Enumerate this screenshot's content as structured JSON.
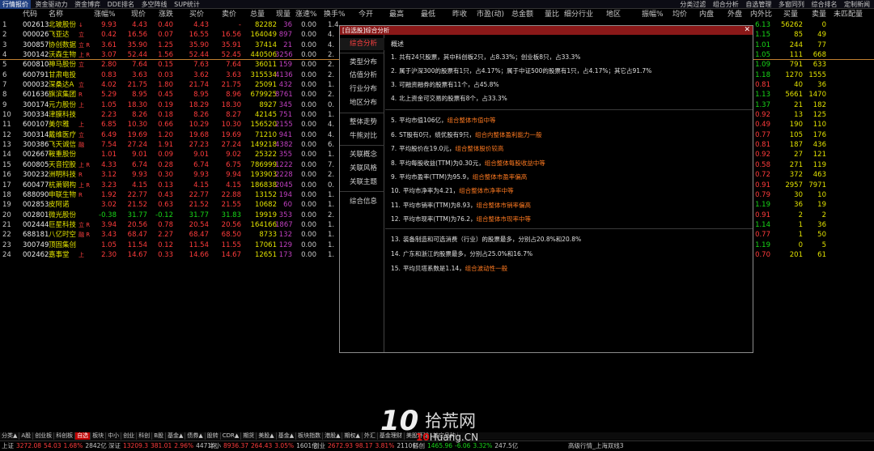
{
  "topbar": {
    "tabs": [
      "行情报价",
      "资金驱动力",
      "资金博弈",
      "DDE排名",
      "多空阵线",
      "SUP统计"
    ],
    "right": [
      "分类过滤",
      "组合分析",
      "自选管理",
      "多窗同列",
      "综合排名",
      "定制新闻"
    ]
  },
  "columns": {
    "idx": "",
    "code": "代码",
    "name": "名称",
    "chg": "涨幅%",
    "price": "现价",
    "delta": "涨跌",
    "buy": "买价",
    "sell": "卖价",
    "vol": "总量",
    "cur": "现量",
    "speed": "涨速%",
    "turn": "换手%",
    "open": "今开",
    "high": "最高",
    "low": "最低",
    "prev": "昨收",
    "pe": "市盈(动)",
    "amount": "总金额",
    "ratio": "量比",
    "industry": "细分行业",
    "region": "地区",
    "amp": "振幅%",
    "avg": "均价",
    "inner": "内盘",
    "outer": "外盘",
    "io": "内外比",
    "bidv": "买量",
    "askv": "卖量",
    "unmatched": "未匹配量"
  },
  "rows": [
    {
      "idx": "1",
      "code": "002613",
      "name": "北玻股份",
      "tag": "↓",
      "chg": "9.93",
      "price": "4.43",
      "delta": "0.40",
      "buy": "4.43",
      "sell": "-",
      "vol": "82282",
      "cur": "36",
      "speed": "0.00",
      "turn": "1.4",
      "io": "6.13",
      "bidv": "56262",
      "askv": "0",
      "dir": "up"
    },
    {
      "idx": "2",
      "code": "000026",
      "name": "飞亚达",
      "tag": "立",
      "chg": "0.42",
      "price": "16.56",
      "delta": "0.07",
      "buy": "16.55",
      "sell": "16.56",
      "vol": "164049",
      "cur": "897",
      "speed": "0.00",
      "turn": "4.",
      "io": "1.15",
      "bidv": "85",
      "askv": "49",
      "dir": "up"
    },
    {
      "idx": "3",
      "code": "300857",
      "name": "协创数据",
      "tag": "立 R",
      "chg": "3.61",
      "price": "35.90",
      "delta": "1.25",
      "buy": "35.90",
      "sell": "35.91",
      "vol": "37414",
      "cur": "21",
      "speed": "0.00",
      "turn": "4.",
      "io": "1.01",
      "bidv": "244",
      "askv": "77",
      "dir": "up"
    },
    {
      "idx": "4",
      "code": "300142",
      "name": "沃森生物",
      "tag": "上 R",
      "chg": "3.07",
      "price": "52.44",
      "delta": "1.56",
      "buy": "52.44",
      "sell": "52.45",
      "vol": "440506",
      "cur": "3256",
      "speed": "0.00",
      "turn": "2.",
      "io": "1.05",
      "bidv": "111",
      "askv": "668",
      "dir": "up",
      "sel": true
    },
    {
      "idx": "5",
      "code": "600810",
      "name": "神马股份",
      "tag": "立",
      "chg": "2.80",
      "price": "7.64",
      "delta": "0.15",
      "buy": "7.63",
      "sell": "7.64",
      "vol": "36011",
      "cur": "159",
      "speed": "0.00",
      "turn": "2.",
      "io": "1.09",
      "bidv": "791",
      "askv": "633",
      "dir": "up"
    },
    {
      "idx": "6",
      "code": "600791",
      "name": "甘肃电投",
      "tag": "",
      "chg": "0.83",
      "price": "3.63",
      "delta": "0.03",
      "buy": "3.62",
      "sell": "3.63",
      "vol": "315534",
      "cur": "4136",
      "speed": "0.00",
      "turn": "2.",
      "io": "1.18",
      "bidv": "1270",
      "askv": "1555",
      "dir": "up"
    },
    {
      "idx": "7",
      "code": "000032",
      "name": "深桑达A",
      "tag": "立",
      "chg": "4.02",
      "price": "21.75",
      "delta": "1.80",
      "buy": "21.74",
      "sell": "21.75",
      "vol": "25091",
      "cur": "432",
      "speed": "0.00",
      "turn": "1.",
      "io": "0.81",
      "bidv": "40",
      "askv": "36",
      "dir": "up"
    },
    {
      "idx": "8",
      "code": "601636",
      "name": "旗滨集团",
      "tag": "R",
      "chg": "5.29",
      "price": "8.95",
      "delta": "0.45",
      "buy": "8.95",
      "sell": "8.96",
      "vol": "679925",
      "cur": "8761",
      "speed": "0.00",
      "turn": "2.",
      "io": "1.13",
      "bidv": "5661",
      "askv": "1470",
      "dir": "up"
    },
    {
      "idx": "9",
      "code": "300174",
      "name": "元力股份",
      "tag": "上",
      "chg": "1.05",
      "price": "18.30",
      "delta": "0.19",
      "buy": "18.29",
      "sell": "18.30",
      "vol": "8927",
      "cur": "345",
      "speed": "0.00",
      "turn": "0.",
      "io": "1.37",
      "bidv": "21",
      "askv": "182",
      "dir": "up"
    },
    {
      "idx": "10",
      "code": "300334",
      "name": "津膜科技",
      "tag": "",
      "chg": "2.23",
      "price": "8.26",
      "delta": "0.18",
      "buy": "8.26",
      "sell": "8.27",
      "vol": "42145",
      "cur": "751",
      "speed": "0.00",
      "turn": "1.",
      "io": "0.92",
      "bidv": "13",
      "askv": "125",
      "dir": "up"
    },
    {
      "idx": "11",
      "code": "600107",
      "name": "美尔雅",
      "tag": "上",
      "chg": "6.85",
      "price": "10.30",
      "delta": "0.66",
      "buy": "10.29",
      "sell": "10.30",
      "vol": "156520",
      "cur": "2155",
      "speed": "0.00",
      "turn": "4.",
      "io": "0.49",
      "bidv": "190",
      "askv": "110",
      "dir": "up"
    },
    {
      "idx": "12",
      "code": "300314",
      "name": "戴维医疗",
      "tag": "立",
      "chg": "6.49",
      "price": "19.69",
      "delta": "1.20",
      "buy": "19.68",
      "sell": "19.69",
      "vol": "71210",
      "cur": "941",
      "speed": "0.00",
      "turn": "4.",
      "io": "0.77",
      "bidv": "105",
      "askv": "176",
      "dir": "up"
    },
    {
      "idx": "13",
      "code": "300386",
      "name": "飞天诚信",
      "tag": "融",
      "chg": "7.54",
      "price": "27.24",
      "delta": "1.91",
      "buy": "27.23",
      "sell": "27.24",
      "vol": "149218",
      "cur": "4382",
      "speed": "0.00",
      "turn": "6.",
      "io": "0.81",
      "bidv": "187",
      "askv": "436",
      "dir": "up"
    },
    {
      "idx": "14",
      "code": "002667",
      "name": "鞍重股份",
      "tag": "",
      "chg": "1.01",
      "price": "9.01",
      "delta": "0.09",
      "buy": "9.01",
      "sell": "9.02",
      "vol": "25322",
      "cur": "355",
      "speed": "0.00",
      "turn": "1.",
      "io": "0.92",
      "bidv": "27",
      "askv": "121",
      "dir": "up"
    },
    {
      "idx": "15",
      "code": "600805",
      "name": "天音控股",
      "tag": "上 R",
      "chg": "4.33",
      "price": "6.74",
      "delta": "0.28",
      "buy": "6.74",
      "sell": "6.75",
      "vol": "786999",
      "cur": "1222",
      "speed": "0.00",
      "turn": "7.",
      "io": "0.58",
      "bidv": "271",
      "askv": "119",
      "dir": "up"
    },
    {
      "idx": "16",
      "code": "300232",
      "name": "洲明科技",
      "tag": "R",
      "chg": "3.12",
      "price": "9.93",
      "delta": "0.30",
      "buy": "9.93",
      "sell": "9.94",
      "vol": "193903",
      "cur": "2228",
      "speed": "0.00",
      "turn": "2.",
      "io": "0.72",
      "bidv": "372",
      "askv": "463",
      "dir": "up"
    },
    {
      "idx": "17",
      "code": "600477",
      "name": "杭萧钢构",
      "tag": "上 R",
      "chg": "3.23",
      "price": "4.15",
      "delta": "0.13",
      "buy": "4.15",
      "sell": "4.15",
      "vol": "186838",
      "cur": "2045",
      "speed": "0.00",
      "turn": "0.",
      "io": "0.91",
      "bidv": "2957",
      "askv": "7971",
      "dir": "up"
    },
    {
      "idx": "18",
      "code": "688090",
      "name": "申联生物",
      "tag": "R",
      "chg": "1.92",
      "price": "22.77",
      "delta": "0.43",
      "buy": "22.77",
      "sell": "22.88",
      "vol": "13152",
      "cur": "194",
      "speed": "0.00",
      "turn": "1.",
      "io": "0.79",
      "bidv": "30",
      "askv": "10",
      "dir": "up"
    },
    {
      "idx": "19",
      "code": "002853",
      "name": "皮阿诺",
      "tag": "",
      "chg": "3.02",
      "price": "21.52",
      "delta": "0.63",
      "buy": "21.52",
      "sell": "21.55",
      "vol": "10682",
      "cur": "60",
      "speed": "0.00",
      "turn": "1.",
      "io": "1.19",
      "bidv": "36",
      "askv": "19",
      "dir": "up"
    },
    {
      "idx": "20",
      "code": "002801",
      "name": "微光股份",
      "tag": "",
      "chg": "-0.38",
      "price": "31.77",
      "delta": "-0.12",
      "buy": "31.77",
      "sell": "31.83",
      "vol": "19919",
      "cur": "353",
      "speed": "0.00",
      "turn": "2.",
      "io": "0.91",
      "bidv": "2",
      "askv": "2",
      "dir": "dn"
    },
    {
      "idx": "21",
      "code": "002444",
      "name": "巨星科技",
      "tag": "立 R",
      "chg": "3.94",
      "price": "20.56",
      "delta": "0.78",
      "buy": "20.54",
      "sell": "20.56",
      "vol": "164166",
      "cur": "1867",
      "speed": "0.00",
      "turn": "1.",
      "io": "1.14",
      "bidv": "1",
      "askv": "36",
      "dir": "up"
    },
    {
      "idx": "22",
      "code": "688181",
      "name": "八亿时空",
      "tag": "融 R",
      "chg": "3.43",
      "price": "68.47",
      "delta": "2.27",
      "buy": "68.47",
      "sell": "68.50",
      "vol": "8733",
      "cur": "132",
      "speed": "0.00",
      "turn": "1.",
      "io": "0.77",
      "bidv": "1",
      "askv": "50",
      "dir": "up"
    },
    {
      "idx": "23",
      "code": "300749",
      "name": "顶固集创",
      "tag": "",
      "chg": "1.05",
      "price": "11.54",
      "delta": "0.12",
      "buy": "11.54",
      "sell": "11.55",
      "vol": "17061",
      "cur": "129",
      "speed": "0.00",
      "turn": "1.",
      "io": "1.19",
      "bidv": "0",
      "askv": "5",
      "dir": "up"
    },
    {
      "idx": "24",
      "code": "002462",
      "name": "嘉事堂",
      "tag": "上",
      "chg": "2.30",
      "price": "14.67",
      "delta": "0.33",
      "buy": "14.66",
      "sell": "14.67",
      "vol": "12651",
      "cur": "173",
      "speed": "0.00",
      "turn": "1.",
      "io": "0.70",
      "bidv": "201",
      "askv": "61",
      "dir": "up"
    }
  ],
  "panel": {
    "title": "[自选股]综合分析",
    "nav": [
      "综合分析",
      "类型分布",
      "估值分析",
      "行业分布",
      "地区分布",
      "整体走势",
      "牛熊对比",
      "关联概念",
      "关联风格",
      "关联主题",
      "综合信息"
    ],
    "heading": "概述",
    "lines": [
      {
        "n": "1.",
        "text": "共有24只股票，其中科创板2只，占8.33%；创业板8只，占33.3%",
        "hl": ""
      },
      {
        "n": "2.",
        "text": "属于沪深300的股票有1只，占4.17%；属于中证500的股票有1只，占4.17%；其它占91.7%",
        "hl": ""
      },
      {
        "n": "3.",
        "text": "可融资融券的股票有11个，占45.8%",
        "hl": ""
      },
      {
        "n": "4.",
        "text": "北上资金可交易的股票有8个，占33.3%",
        "hl": ""
      },
      {
        "n": "5.",
        "text": "平均市值106亿，",
        "hl": "组合整体市值中等"
      },
      {
        "n": "6.",
        "text": "ST股有0只，绩优股有9只，",
        "hl": "组合内整体盈利能力一般"
      },
      {
        "n": "7.",
        "text": "平均股价在19.0元，",
        "hl": "组合整体股价较高"
      },
      {
        "n": "8.",
        "text": "平均每股收益(TTM)为0.30元，",
        "hl": "组合整体每股收益中等"
      },
      {
        "n": "9.",
        "text": "平均市盈率(TTM)为95.9，",
        "hl": "组合整体市盈率偏高"
      },
      {
        "n": "10.",
        "text": "平均市净率为4.21，",
        "hl": "组合整体市净率中等"
      },
      {
        "n": "11.",
        "text": "平均市销率(TTM)为8.93，",
        "hl": "组合整体市销率偏高"
      },
      {
        "n": "12.",
        "text": "平均市现率(TTM)为76.2，",
        "hl": "组合整体市现率中等"
      },
      {
        "n": "13.",
        "text": "装备制造和可选消费（行业）的股票最多，分别占20.8%和20.8%",
        "hl": ""
      },
      {
        "n": "14.",
        "text": "广东和浙江的股票最多，分别占25.0%和16.7%",
        "hl": ""
      },
      {
        "n": "15.",
        "text": "平均贝塔系数是1.14，",
        "hl": "组合波动性一般"
      }
    ]
  },
  "bottomtabs": [
    "分类▲",
    "A股",
    "创业板",
    "科创板",
    "自选",
    "板块",
    "中小",
    "创业",
    "科创",
    "B股",
    "基金▲",
    "债券▲",
    "股转",
    "CDR▲",
    "期货",
    "美股▲",
    "基金▲",
    "板块指数",
    "港股▲",
    "期权▲",
    "外汇",
    "基金理财",
    "美股环球",
    "其它品种"
  ],
  "status": [
    {
      "label": "上证",
      "v1": "3272.08",
      "v2": "54.03",
      "v3": "1.68%",
      "v4": "2842亿"
    },
    {
      "label": "深证",
      "v1": "13209.3",
      "v2": "381.01",
      "v3": "2.96%",
      "v4": "4471亿"
    },
    {
      "label": "中小",
      "v1": "8936.37",
      "v2": "264.43",
      "v3": "3.05%",
      "v4": "1601亿"
    },
    {
      "label": "创业",
      "v1": "2672.93",
      "v2": "98.17",
      "v3": "3.81%",
      "v4": "2110亿"
    },
    {
      "label": "科创",
      "v1": "1465.96",
      "v2": "-6.06",
      "v3": "3.32%",
      "v4": "247.5亿"
    }
  ],
  "statusright": "高级行情_上海双线3",
  "watermark": {
    "num": "10",
    "cn": "拾荒网",
    "en": "Huang.CN",
    "en_prefix": "10"
  },
  "colors": {
    "up": "#ff3c3c",
    "down": "#18d818",
    "highlight": "#ff7a20",
    "title": "#8a1818"
  }
}
